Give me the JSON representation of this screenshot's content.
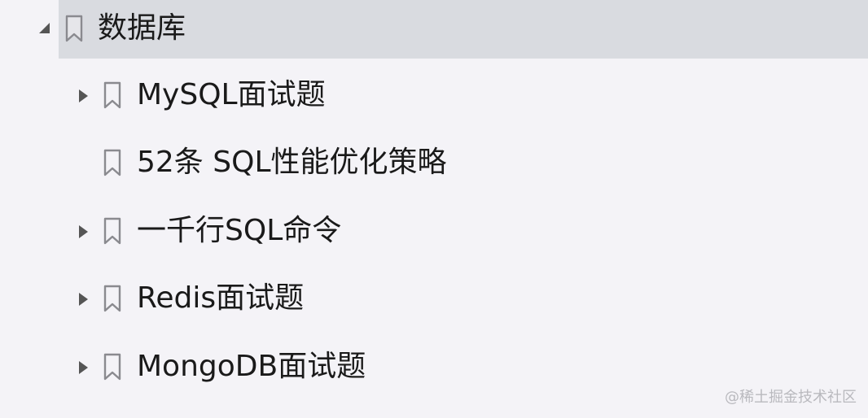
{
  "tree": {
    "root": {
      "label": "数据库",
      "expanded": true,
      "selected": true
    },
    "children": [
      {
        "label": "MySQL面试题",
        "has_children": true
      },
      {
        "label": "52条 SQL性能优化策略",
        "has_children": false
      },
      {
        "label": "一千行SQL命令",
        "has_children": true
      },
      {
        "label": "Redis面试题",
        "has_children": true
      },
      {
        "label": "MongoDB面试题",
        "has_children": true
      }
    ]
  },
  "watermark": "@稀土掘金技术社区",
  "colors": {
    "background": "#f4f3f7",
    "selected_row": "#d9dbe0",
    "bookmark_stroke": "#8a8a8f",
    "arrow": "#555555",
    "text": "#1a1a1a"
  },
  "icons": {
    "root_toggle": "triangle-down-icon",
    "child_toggle": "triangle-right-icon",
    "item": "bookmark-icon"
  }
}
